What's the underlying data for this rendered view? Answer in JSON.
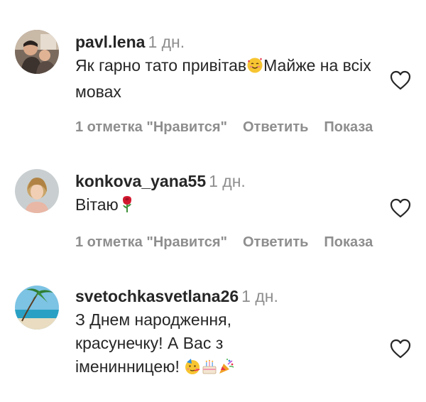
{
  "comments": [
    {
      "username": "pavl.lena",
      "time": "1 дн.",
      "text_before": "Як гарно тато привітав",
      "emoji_1": "smiling-face-with-hearts",
      "text_after": "Майже на всіх мовах",
      "likes": "1 отметка \"Нравится\"",
      "reply": "Ответить",
      "show": "Показа"
    },
    {
      "username": "konkova_yana55",
      "time": "1 дн.",
      "text_before": "Вітаю",
      "emoji_1": "rose",
      "likes": "1 отметка \"Нравится\"",
      "reply": "Ответить",
      "show": "Показа"
    },
    {
      "username": "svetochkasvetlana26",
      "time": "1 дн.",
      "text_line1": "З Днем народження,",
      "text_line2": "красунечку! А Вас з",
      "text_line3": "іменинницею!",
      "emoji_1": "partying-face",
      "emoji_2": "birthday-cake",
      "emoji_3": "party-popper"
    }
  ],
  "colors": {
    "text": "#262626",
    "secondary": "#8e8e8e",
    "background": "#ffffff"
  }
}
